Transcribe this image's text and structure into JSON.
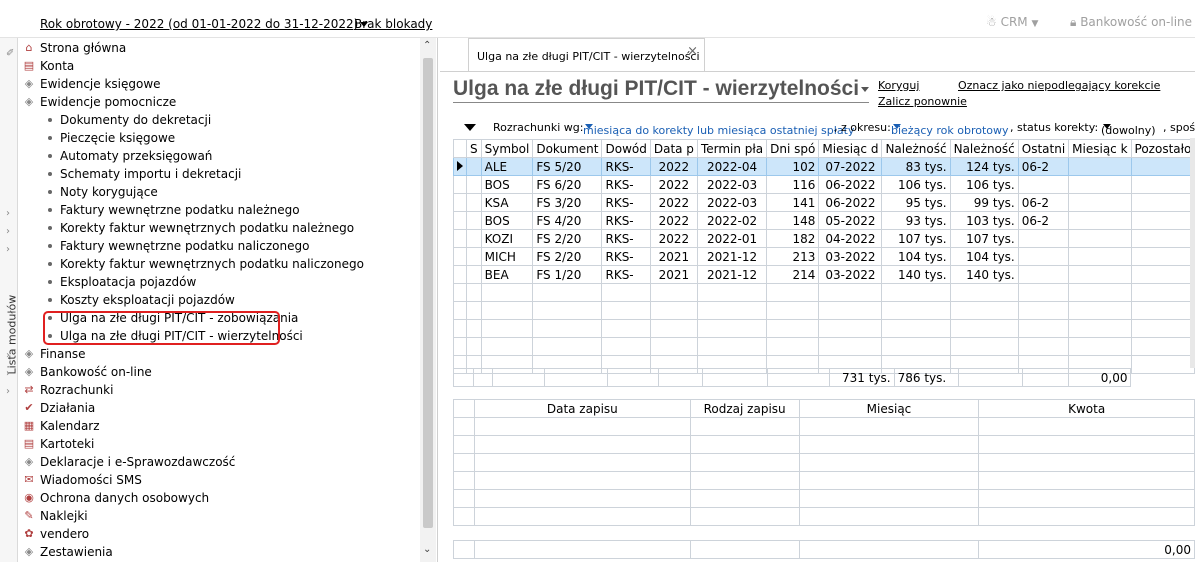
{
  "topbar": {
    "fiscal_year": "Rok obrotowy - 2022  (od 01-01-2022 do 31-12-2022)",
    "lock": "Brak blokady",
    "crm": "CRM",
    "bank": "Bankowość on-line"
  },
  "strip": {
    "label": "Lista modułów"
  },
  "nav": {
    "items": [
      {
        "label": "Strona główna",
        "icon": "home-icon"
      },
      {
        "label": "Konta",
        "icon": "accounts-icon"
      },
      {
        "label": "Ewidencje księgowe",
        "icon": "ledger-icon"
      },
      {
        "label": "Ewidencje pomocnicze",
        "icon": "ledger-icon"
      }
    ],
    "sub_items": [
      "Dokumenty do dekretacji",
      "Pieczęcie księgowe",
      "Automaty przeksięgowań",
      "Schematy importu i dekretacji",
      "Noty korygujące",
      "Faktury wewnętrzne podatku należnego",
      "Korekty faktur wewnętrznych podatku należnego",
      "Faktury wewnętrzne podatku naliczonego",
      "Korekty faktur wewnętrznych podatku naliczonego",
      "Eksploatacja pojazdów",
      "Koszty eksploatacji pojazdów",
      "Ulga na złe długi PIT/CIT - zobowiązania",
      "Ulga na złe długi PIT/CIT - wierzytelności"
    ],
    "items2": [
      {
        "label": "Finanse",
        "icon": "finance-icon"
      },
      {
        "label": "Bankowość on-line",
        "icon": "bank-icon"
      },
      {
        "label": "Rozrachunki",
        "icon": "settlements-icon"
      },
      {
        "label": "Działania",
        "icon": "actions-icon"
      },
      {
        "label": "Kalendarz",
        "icon": "calendar-icon"
      },
      {
        "label": "Kartoteki",
        "icon": "cards-icon"
      },
      {
        "label": "Deklaracje i e-Sprawozdawczość",
        "icon": "declarations-icon"
      },
      {
        "label": "Wiadomości SMS",
        "icon": "sms-icon"
      },
      {
        "label": "Ochrona danych osobowych",
        "icon": "shield-icon"
      },
      {
        "label": "Naklejki",
        "icon": "sticker-icon"
      },
      {
        "label": "vendero",
        "icon": "vendero-icon"
      },
      {
        "label": "Zestawienia",
        "icon": "report-icon"
      }
    ]
  },
  "main": {
    "tab": "Ulga na złe długi PIT/CIT - wierzytelności",
    "title": "Ulga na złe długi PIT/CIT - wierzytelności",
    "actions": {
      "koryguj": "Koryguj",
      "zalicz": "Zalicz ponownie",
      "oznacz": "Oznacz jako niepodlegający korekcie"
    },
    "filter": {
      "label1": "Rozrachunki wg:",
      "value1": "miesiąca do korekty lub miesiąca ostatniej spłaty",
      "label2": ", z okresu:",
      "value2": "bieżący rok obrotowy",
      "label3": ", status korekty:",
      "value3": "(dowolny)",
      "label4": ", spośr"
    },
    "grid1": {
      "headers": [
        "S",
        "Symbol",
        "Dokument",
        "Dowód",
        "Data p",
        "Termin pła",
        "Dni spó",
        "Miesiąc d",
        "Należność",
        "Należność",
        "Ostatni",
        "Miesiąc k",
        "Pozostało"
      ],
      "rows": [
        [
          "",
          "ALE",
          "FS 5/20",
          "RKS-",
          "2022",
          "2022-04",
          "102",
          "07-2022",
          "83 tys.",
          "124 tys.",
          "06-2",
          "",
          ""
        ],
        [
          "",
          "BOS",
          "FS 6/20",
          "RKS-",
          "2022",
          "2022-03",
          "116",
          "06-2022",
          "106 tys.",
          "106 tys.",
          "",
          "",
          ""
        ],
        [
          "",
          "KSA",
          "FS 3/20",
          "RKS-",
          "2022",
          "2022-03",
          "141",
          "06-2022",
          "95 tys.",
          "99 tys.",
          "06-2",
          "",
          ""
        ],
        [
          "",
          "BOS",
          "FS 4/20",
          "RKS-",
          "2022",
          "2022-02",
          "148",
          "05-2022",
          "93 tys.",
          "103 tys.",
          "06-2",
          "",
          ""
        ],
        [
          "",
          "KOZI",
          "FS 2/20",
          "RKS-",
          "2022",
          "2022-01",
          "182",
          "04-2022",
          "107 tys.",
          "107 tys.",
          "",
          "",
          ""
        ],
        [
          "",
          "MICH",
          "FS 2/20",
          "RKS-",
          "2021",
          "2021-12",
          "213",
          "03-2022",
          "104 tys.",
          "104 tys.",
          "",
          "",
          ""
        ],
        [
          "",
          "BEA",
          "FS 1/20",
          "RKS-",
          "2021",
          "2021-12",
          "214",
          "03-2022",
          "140 tys.",
          "140 tys.",
          "",
          "",
          ""
        ]
      ],
      "totals": {
        "naleznosc1": "731 tys.",
        "naleznosc2": "786 tys.",
        "pozostalo": "0,00"
      }
    },
    "grid2": {
      "headers": [
        "Data zapisu",
        "Rodzaj zapisu",
        "Miesiąc",
        "Kwota"
      ],
      "total": "0,00"
    }
  }
}
